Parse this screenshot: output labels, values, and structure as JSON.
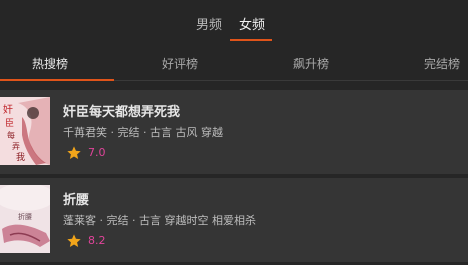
{
  "gender_tabs": [
    {
      "label": "男频",
      "active": false
    },
    {
      "label": "女频",
      "active": true
    }
  ],
  "rank_tabs": [
    {
      "label": "热搜榜",
      "active": true
    },
    {
      "label": "好评榜",
      "active": false
    },
    {
      "label": "飙升榜",
      "active": false
    },
    {
      "label": "完结榜",
      "active": false
    }
  ],
  "books": [
    {
      "title": "奸臣每天都想弄死我",
      "meta": "千苒君笑 · 完结 · 古言 古风 穿越",
      "score": "7.0",
      "cover_text": "奸臣每天都想弄死我"
    },
    {
      "title": "折腰",
      "meta": "蓬莱客 · 完结 · 古言 穿越时空 相爱相杀",
      "score": "8.2",
      "cover_text": "折腰"
    }
  ],
  "colors": {
    "accent": "#e0541a",
    "score": "#e0449a",
    "star": "#f2a51a"
  }
}
